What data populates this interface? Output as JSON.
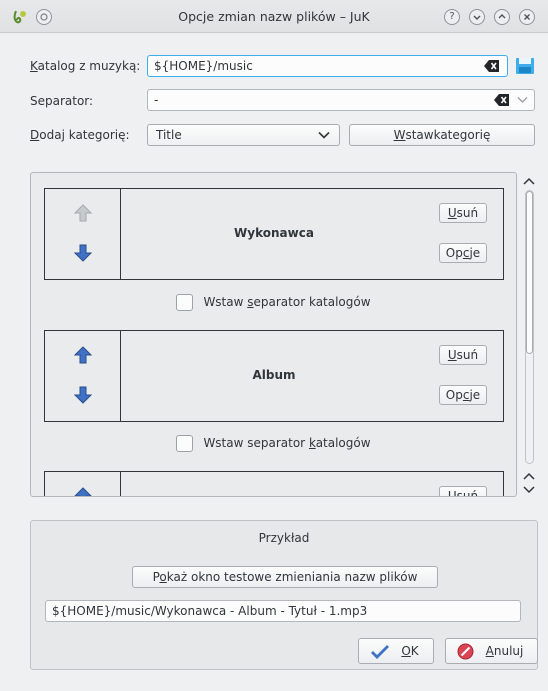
{
  "window": {
    "title": "Opcje zmian nazw plików – JuK",
    "help_glyph": "?",
    "minimize_glyph": "⌄",
    "maximize_glyph": "⌃",
    "close_glyph": "×"
  },
  "form": {
    "music_folder_label_pre": "",
    "music_folder_label_key": "K",
    "music_folder_label_post": "atalog z muzyką:",
    "music_folder_value": "${HOME}/music",
    "separator_label": "Separator:",
    "separator_value": "-",
    "add_category_label_key": "D",
    "add_category_label_post": "odaj kategorię:",
    "category_selected": "Title",
    "insert_category_key": "W",
    "insert_category_post": "stawkategorię"
  },
  "categories": [
    {
      "name": "Wykonawca",
      "up_enabled": false,
      "down_enabled": true
    },
    {
      "name": "Album",
      "up_enabled": true,
      "down_enabled": true
    },
    {
      "name": "",
      "up_enabled": true,
      "down_enabled": true
    }
  ],
  "buttons": {
    "remove_key": "U",
    "remove_post": "suń",
    "options_pre": "Op",
    "options_key": "c",
    "options_post": "je"
  },
  "separators": {
    "row1_pre": "Wstaw ",
    "row1_key": "s",
    "row1_post": "eparator katalogów",
    "row2_pre": "Wstaw separator ",
    "row2_key": "k",
    "row2_post": "atalogów"
  },
  "example": {
    "title": "Przykład",
    "show_test_pre": "P",
    "show_test_key": "o",
    "show_test_post": "każ okno testowe zmieniania nazw plików",
    "value": "${HOME}/music/Wykonawca - Album - Tytuł - 1.mp3"
  },
  "dialog": {
    "ok_key": "O",
    "ok_post": "K",
    "cancel_key": "A",
    "cancel_post": "nuluj"
  },
  "colors": {
    "accent": "#3daee9",
    "arrow_blue": "#3f72c4",
    "cancel_red": "#da4453"
  },
  "icons": {
    "app": "juk-icon",
    "save": "save-icon",
    "clear": "clear-text-icon"
  }
}
